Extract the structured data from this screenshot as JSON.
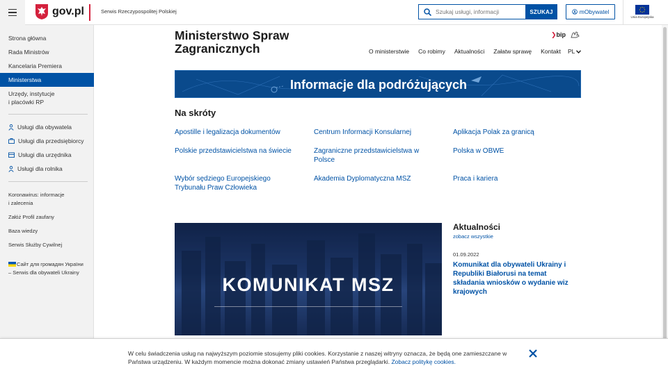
{
  "header": {
    "menu_label": "menu",
    "logo_text": "gov.pl",
    "serwis_label": "Serwis Rzeczypospolitej Polskiej",
    "search": {
      "placeholder": "Szukaj usługi, informacji",
      "button_label": "SZUKAJ"
    },
    "mobywatel_label": "mObywatel",
    "eu_label": "Unia Europejska"
  },
  "sidebar": {
    "main_items": [
      {
        "label": "Strona główna"
      },
      {
        "label": "Rada Ministrów"
      },
      {
        "label": "Kancelaria Premiera"
      },
      {
        "label": "Ministerstwa",
        "active": true
      },
      {
        "label": "Urzędy, instytucje\ni placówki RP"
      }
    ],
    "service_items": [
      {
        "label": "Usługi dla obywatela",
        "icon": "person-icon"
      },
      {
        "label": "Usługi dla przedsiębiorcy",
        "icon": "briefcase-icon"
      },
      {
        "label": "Usługi dla urzędnika",
        "icon": "office-icon"
      },
      {
        "label": "Usługi dla rolnika",
        "icon": "person-icon"
      }
    ],
    "extra_items": [
      {
        "label": "Koronawirus: informacje\ni zalecenia"
      },
      {
        "label": "Załóż Profil zaufany"
      },
      {
        "label": "Baza wiedzy"
      },
      {
        "label": "Serwis Służby Cywilnej"
      },
      {
        "label": "Сайт для громадян України\n– Serwis dla obywateli Ukrainy",
        "icon": "ukraine-flag-icon"
      }
    ]
  },
  "main": {
    "ministry_title": "Ministerstwo Spraw\nZagranicznych",
    "bip_label": "bip",
    "nav": [
      "O ministerstwie",
      "Co robimy",
      "Aktualności",
      "Załatw sprawę",
      "Kontakt"
    ],
    "lang": "PL",
    "banner_text": "Informacje dla podróżujących",
    "skroty": {
      "title": "Na skróty",
      "links": [
        "Apostille i legalizacja dokumentów",
        "Centrum Informacji Konsularnej",
        "Aplikacja Polak za granicą",
        "Polskie przedstawicielstwa na świecie",
        "Zagraniczne przedstawicielstwa w Polsce",
        "Polska w OBWE",
        "Wybór sędziego Europejskiego Trybunału Praw Człowieka",
        "Akademia Dyplomatyczna MSZ",
        "Praca i kariera"
      ]
    },
    "photo_text": "KOMUNIKAT MSZ",
    "news": {
      "title": "Aktualności",
      "see_all": "zobacz wszystkie",
      "date": "01.09.2022",
      "headline": "Komunikat dla obywateli Ukrainy i Republiki Białorusi na temat składania wniosków o wydanie wiz krajowych"
    }
  },
  "cookie": {
    "text": "W celu świadczenia usług na najwyższym poziomie stosujemy pliki cookies. Korzystanie z naszej witryny oznacza, że będą one zamieszczane w Państwa urządzeniu. W każdym momencie można dokonać zmiany ustawień Państwa przeglądarki. ",
    "link": "Zobacz politykę cookies."
  },
  "colors": {
    "accent": "#0052a5",
    "brand_red": "#d4213d",
    "sidebar_bg": "#f2f2f2"
  }
}
